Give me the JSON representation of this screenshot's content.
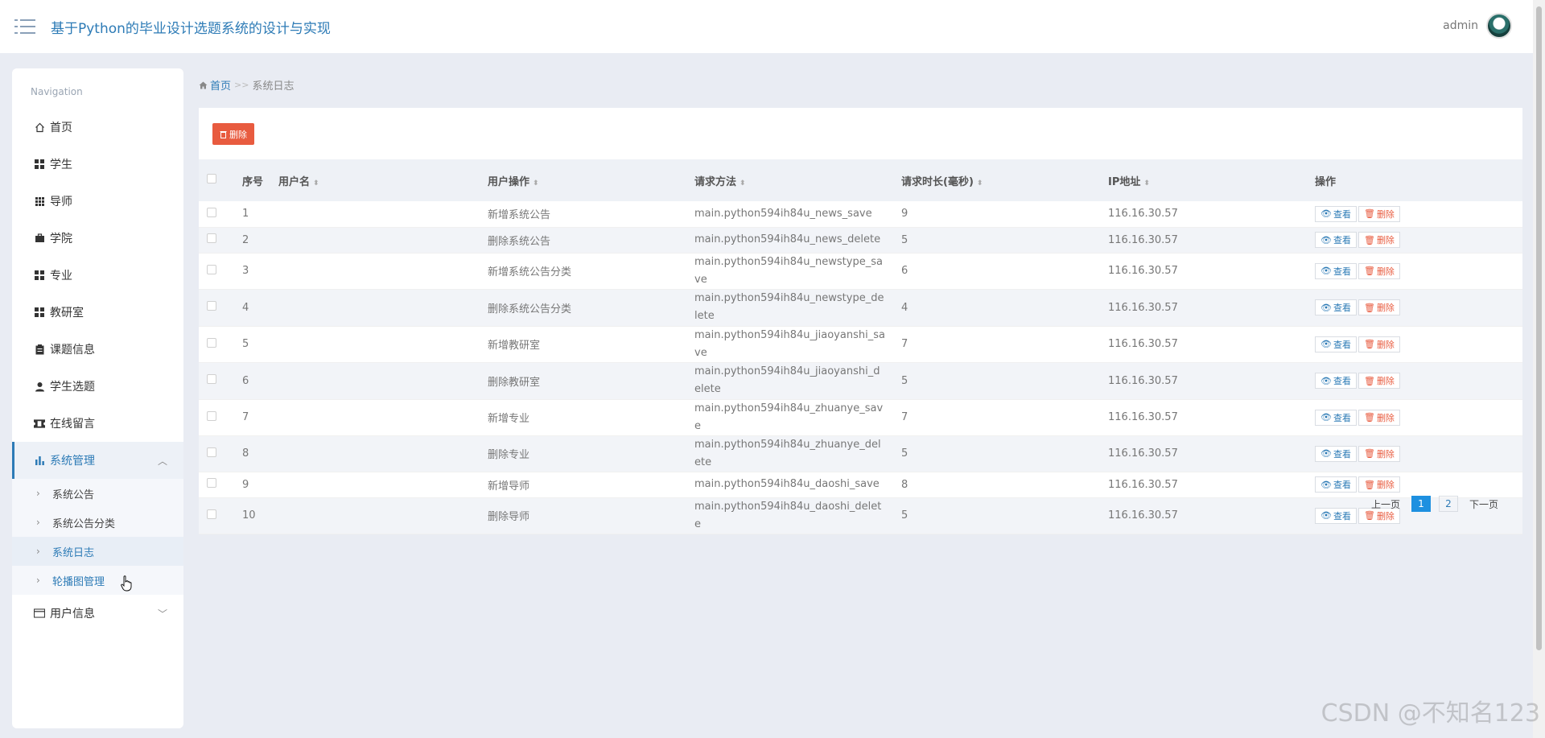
{
  "header": {
    "title": "基于Python的毕业设计选题系统的设计与实现",
    "user": "admin"
  },
  "sidebar": {
    "nav_header": "Navigation",
    "items": [
      {
        "label": "首页",
        "icon": "home-icon"
      },
      {
        "label": "学生",
        "icon": "grid-icon"
      },
      {
        "label": "导师",
        "icon": "grid-9-icon"
      },
      {
        "label": "学院",
        "icon": "briefcase-icon"
      },
      {
        "label": "专业",
        "icon": "grid-icon"
      },
      {
        "label": "教研室",
        "icon": "grid-icon"
      },
      {
        "label": "课题信息",
        "icon": "clipboard-icon"
      },
      {
        "label": "学生选题",
        "icon": "user-icon"
      },
      {
        "label": "在线留言",
        "icon": "ticket-icon"
      },
      {
        "label": "系统管理",
        "icon": "bar-chart-icon"
      },
      {
        "label": "用户信息",
        "icon": "card-icon"
      }
    ],
    "sub_items": [
      {
        "label": "系统公告"
      },
      {
        "label": "系统公告分类"
      },
      {
        "label": "系统日志"
      },
      {
        "label": "轮播图管理"
      }
    ]
  },
  "breadcrumb": {
    "home": "首页",
    "separator": ">>",
    "current": "系统日志"
  },
  "toolbar": {
    "delete_label": "删除"
  },
  "table": {
    "headers": {
      "index": "序号",
      "username": "用户名",
      "operation": "用户操作",
      "method": "请求方法",
      "duration": "请求时长(毫秒)",
      "ip": "IP地址",
      "actions": "操作"
    },
    "rows": [
      {
        "index": "1",
        "username": "",
        "operation": "新增系统公告",
        "method": "main.python594ih84u_news_save",
        "duration": "9",
        "ip": "116.16.30.57"
      },
      {
        "index": "2",
        "username": "",
        "operation": "删除系统公告",
        "method": "main.python594ih84u_news_delete",
        "duration": "5",
        "ip": "116.16.30.57"
      },
      {
        "index": "3",
        "username": "",
        "operation": "新增系统公告分类",
        "method": "main.python594ih84u_newstype_save",
        "duration": "6",
        "ip": "116.16.30.57"
      },
      {
        "index": "4",
        "username": "",
        "operation": "删除系统公告分类",
        "method": "main.python594ih84u_newstype_delete",
        "duration": "4",
        "ip": "116.16.30.57"
      },
      {
        "index": "5",
        "username": "",
        "operation": "新增教研室",
        "method": "main.python594ih84u_jiaoyanshi_save",
        "duration": "7",
        "ip": "116.16.30.57"
      },
      {
        "index": "6",
        "username": "",
        "operation": "删除教研室",
        "method": "main.python594ih84u_jiaoyanshi_delete",
        "duration": "5",
        "ip": "116.16.30.57"
      },
      {
        "index": "7",
        "username": "",
        "operation": "新增专业",
        "method": "main.python594ih84u_zhuanye_save",
        "duration": "7",
        "ip": "116.16.30.57"
      },
      {
        "index": "8",
        "username": "",
        "operation": "删除专业",
        "method": "main.python594ih84u_zhuanye_delete",
        "duration": "5",
        "ip": "116.16.30.57"
      },
      {
        "index": "9",
        "username": "",
        "operation": "新增导师",
        "method": "main.python594ih84u_daoshi_save",
        "duration": "8",
        "ip": "116.16.30.57"
      },
      {
        "index": "10",
        "username": "",
        "operation": "删除导师",
        "method": "main.python594ih84u_daoshi_delete",
        "duration": "5",
        "ip": "116.16.30.57"
      }
    ],
    "view_label": "查看",
    "delete_label": "删除"
  },
  "pagination": {
    "prev": "上一页",
    "pages": [
      "1",
      "2"
    ],
    "next": "下一页"
  },
  "watermark": "CSDN @不知名123",
  "colors": {
    "accent": "#2d7bb6",
    "danger": "#e85b3f",
    "page_active": "#1e90e0",
    "background": "#e9ecf3"
  }
}
